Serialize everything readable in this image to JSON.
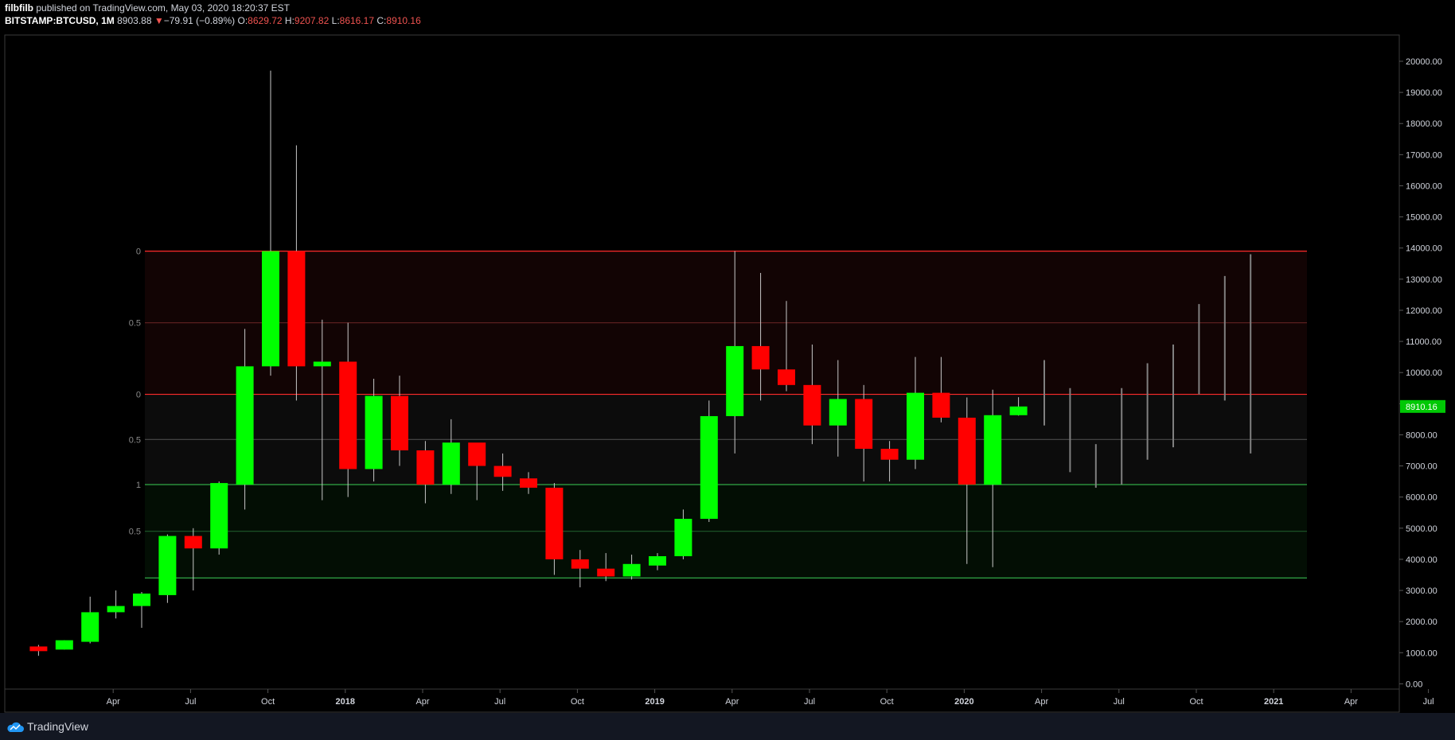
{
  "header": {
    "publisher": "filbfilb",
    "published_text": "published on TradingView.com, May 03, 2020 18:20:37 EST",
    "symbol": "BITSTAMP:BTCUSD, 1M",
    "last": "8903.88",
    "change": "−79.91 (−0.89%)",
    "o_label": "O:",
    "o_value": "8629.72",
    "h_label": "H:",
    "h_value": "9207.82",
    "l_label": "L:",
    "l_value": "8616.17",
    "c_label": "C:",
    "c_value": "8910.16"
  },
  "footer": {
    "brand": "TradingView"
  },
  "colors": {
    "up": "#00ff00",
    "down": "#ff0000",
    "projection": "#808080",
    "price_tag": "#00c805"
  },
  "chart_data": {
    "type": "candlestick",
    "symbol": "BITSTAMP:BTCUSD",
    "interval": "1M",
    "ylim": [
      -200,
      20600
    ],
    "y_ticks": [
      0,
      1000,
      2000,
      3000,
      4000,
      5000,
      6000,
      7000,
      8000,
      9000,
      10000,
      11000,
      12000,
      13000,
      14000,
      15000,
      16000,
      17000,
      18000,
      19000,
      20000
    ],
    "y_tick_labels": [
      "0.00",
      "1000.00",
      "2000.00",
      "3000.00",
      "4000.00",
      "5000.00",
      "6000.00",
      "7000.00",
      "8000.00",
      "9000.00",
      "10000.00",
      "11000.00",
      "12000.00",
      "13000.00",
      "14000.00",
      "15000.00",
      "16000.00",
      "17000.00",
      "18000.00",
      "19000.00",
      "20000.00"
    ],
    "x_ticks": [
      {
        "label": "Apr",
        "i": 3,
        "bold": false
      },
      {
        "label": "Jul",
        "i": 6,
        "bold": false
      },
      {
        "label": "Oct",
        "i": 9,
        "bold": false
      },
      {
        "label": "2018",
        "i": 12,
        "bold": true
      },
      {
        "label": "Apr",
        "i": 15,
        "bold": false
      },
      {
        "label": "Jul",
        "i": 18,
        "bold": false
      },
      {
        "label": "Oct",
        "i": 21,
        "bold": false
      },
      {
        "label": "2019",
        "i": 24,
        "bold": true
      },
      {
        "label": "Apr",
        "i": 27,
        "bold": false
      },
      {
        "label": "Jul",
        "i": 30,
        "bold": false
      },
      {
        "label": "Oct",
        "i": 33,
        "bold": false
      },
      {
        "label": "2020",
        "i": 36,
        "bold": true
      },
      {
        "label": "Apr",
        "i": 39,
        "bold": false
      },
      {
        "label": "Jul",
        "i": 42,
        "bold": false
      },
      {
        "label": "Oct",
        "i": 45,
        "bold": false
      },
      {
        "label": "2021",
        "i": 48,
        "bold": true
      },
      {
        "label": "Apr",
        "i": 51,
        "bold": false
      },
      {
        "label": "Jul",
        "i": 54,
        "bold": false
      }
    ],
    "candles": [
      {
        "i": 1,
        "o": 1200,
        "h": 1250,
        "l": 900,
        "c": 1050
      },
      {
        "i": 2,
        "o": 1100,
        "h": 1400,
        "l": 1100,
        "c": 1400
      },
      {
        "i": 3,
        "o": 1350,
        "h": 2800,
        "l": 1300,
        "c": 2300
      },
      {
        "i": 4,
        "o": 2300,
        "h": 3000,
        "l": 2100,
        "c": 2500
      },
      {
        "i": 5,
        "o": 2500,
        "h": 2950,
        "l": 1800,
        "c": 2900
      },
      {
        "i": 6,
        "o": 2850,
        "h": 4800,
        "l": 2600,
        "c": 4750
      },
      {
        "i": 7,
        "o": 4750,
        "h": 5000,
        "l": 3000,
        "c": 4350
      },
      {
        "i": 8,
        "o": 4350,
        "h": 6500,
        "l": 4150,
        "c": 6450
      },
      {
        "i": 9,
        "o": 6400,
        "h": 11400,
        "l": 5600,
        "c": 10200
      },
      {
        "i": 10,
        "o": 10200,
        "h": 19700,
        "l": 9900,
        "c": 13900
      },
      {
        "i": 11,
        "o": 13900,
        "h": 17300,
        "l": 9100,
        "c": 10200
      },
      {
        "i": 12,
        "o": 10200,
        "h": 11700,
        "l": 5900,
        "c": 10350
      },
      {
        "i": 13,
        "o": 10350,
        "h": 11600,
        "l": 6000,
        "c": 6900
      },
      {
        "i": 14,
        "o": 6900,
        "h": 9800,
        "l": 6500,
        "c": 9250
      },
      {
        "i": 15,
        "o": 9250,
        "h": 9900,
        "l": 7000,
        "c": 7500
      },
      {
        "i": 16,
        "o": 7500,
        "h": 7800,
        "l": 5800,
        "c": 6400
      },
      {
        "i": 17,
        "o": 6400,
        "h": 8500,
        "l": 6100,
        "c": 7750
      },
      {
        "i": 18,
        "o": 7750,
        "h": 7700,
        "l": 5900,
        "c": 7000
      },
      {
        "i": 19,
        "o": 7000,
        "h": 7400,
        "l": 6200,
        "c": 6650
      },
      {
        "i": 20,
        "o": 6600,
        "h": 6800,
        "l": 6100,
        "c": 6300
      },
      {
        "i": 21,
        "o": 6300,
        "h": 6450,
        "l": 3500,
        "c": 4000
      },
      {
        "i": 22,
        "o": 4000,
        "h": 4300,
        "l": 3100,
        "c": 3700
      },
      {
        "i": 23,
        "o": 3700,
        "h": 4200,
        "l": 3300,
        "c": 3450
      },
      {
        "i": 24,
        "o": 3450,
        "h": 4150,
        "l": 3350,
        "c": 3850
      },
      {
        "i": 25,
        "o": 3800,
        "h": 4200,
        "l": 3650,
        "c": 4100
      },
      {
        "i": 26,
        "o": 4100,
        "h": 5600,
        "l": 4000,
        "c": 5300
      },
      {
        "i": 27,
        "o": 5300,
        "h": 9100,
        "l": 5200,
        "c": 8600
      },
      {
        "i": 28,
        "o": 8600,
        "h": 13900,
        "l": 7400,
        "c": 10850
      },
      {
        "i": 29,
        "o": 10850,
        "h": 13200,
        "l": 9100,
        "c": 10100
      },
      {
        "i": 30,
        "o": 10100,
        "h": 12300,
        "l": 9400,
        "c": 9600
      },
      {
        "i": 31,
        "o": 9600,
        "h": 10900,
        "l": 7700,
        "c": 8300
      },
      {
        "i": 32,
        "o": 8300,
        "h": 10400,
        "l": 7300,
        "c": 9150
      },
      {
        "i": 33,
        "o": 9150,
        "h": 9600,
        "l": 6500,
        "c": 7550
      },
      {
        "i": 34,
        "o": 7550,
        "h": 7800,
        "l": 6500,
        "c": 7200
      },
      {
        "i": 35,
        "o": 7200,
        "h": 10500,
        "l": 6900,
        "c": 9350
      },
      {
        "i": 36,
        "o": 9350,
        "h": 10500,
        "l": 8400,
        "c": 8550
      },
      {
        "i": 37,
        "o": 8550,
        "h": 9200,
        "l": 3850,
        "c": 6400
      },
      {
        "i": 38,
        "o": 6400,
        "h": 9450,
        "l": 3750,
        "c": 8630
      },
      {
        "i": 39,
        "o": 8630,
        "h": 9208,
        "l": 8616,
        "c": 8910
      }
    ],
    "projection_ranges": [
      {
        "i": 40,
        "l": 8300,
        "h": 10400
      },
      {
        "i": 41,
        "l": 6800,
        "h": 9500
      },
      {
        "i": 42,
        "l": 6300,
        "h": 7700
      },
      {
        "i": 43,
        "l": 6400,
        "h": 9500
      },
      {
        "i": 44,
        "l": 7200,
        "h": 10300
      },
      {
        "i": 45,
        "l": 7600,
        "h": 10900
      },
      {
        "i": 46,
        "l": 9300,
        "h": 12200
      },
      {
        "i": 47,
        "l": 9100,
        "h": 13100
      },
      {
        "i": 48,
        "l": 7400,
        "h": 13800
      }
    ],
    "levels": [
      {
        "value": 13900,
        "label": "0",
        "color": "#ff2b2b"
      },
      {
        "value": 11600,
        "label": "0.5",
        "color": "#5a1f1f"
      },
      {
        "value": 9300,
        "label": "0",
        "color": "#ff2b2b"
      },
      {
        "value": 7850,
        "label": "0.5",
        "color": "#4a4a4a"
      },
      {
        "value": 6400,
        "label": "1",
        "color": "#31a846"
      },
      {
        "value": 4900,
        "label": "0.5",
        "color": "#1f5a2a"
      },
      {
        "value": 3400,
        "label": "",
        "color": "#31a846"
      }
    ],
    "zones": [
      {
        "from": 9300,
        "to": 13900,
        "color": "#120404"
      },
      {
        "from": 6400,
        "to": 9300,
        "color": "#0c0c0c"
      },
      {
        "from": 3400,
        "to": 6400,
        "color": "#030e04"
      }
    ],
    "level_range_i": [
      5,
      50
    ],
    "last_price": "8910.16"
  }
}
